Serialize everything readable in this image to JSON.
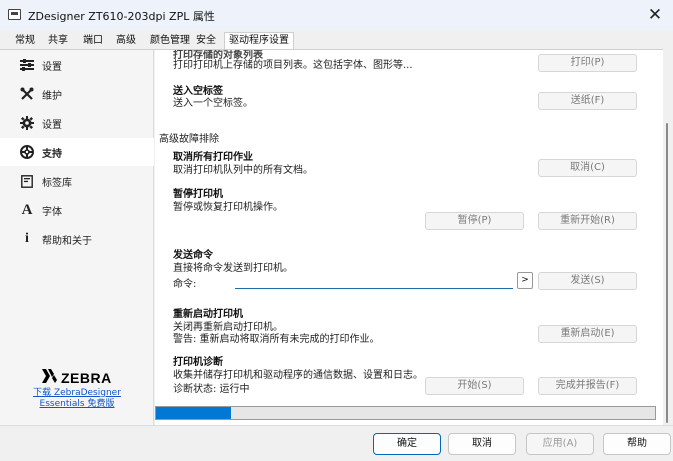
{
  "window": {
    "title": "ZDesigner ZT610-203dpi ZPL 属性",
    "close_glyph": "✕"
  },
  "tabs": [
    {
      "label": "常规"
    },
    {
      "label": "共享"
    },
    {
      "label": "端口"
    },
    {
      "label": "高级"
    },
    {
      "label": "颜色管理"
    },
    {
      "label": "安全"
    },
    {
      "label": "驱动程序设置",
      "active": true
    }
  ],
  "sidebar": {
    "items": [
      {
        "label": "设置",
        "icon": "sliders-icon"
      },
      {
        "label": "维护",
        "icon": "tools-icon"
      },
      {
        "label": "设置",
        "icon": "gear-icon"
      },
      {
        "label": "支持",
        "icon": "lifebuoy-icon",
        "active": true
      },
      {
        "label": "标签库",
        "icon": "label-library-icon"
      },
      {
        "label": "字体",
        "icon": "font-icon"
      },
      {
        "label": "帮助和关于",
        "icon": "info-icon"
      }
    ],
    "brand": {
      "name": "ZEBRA",
      "link_line1": "下载 ZebraDesigner",
      "link_line2": "Essentials 免费版"
    }
  },
  "content": {
    "overflow_title": "打印存储的对象列表",
    "stored_objects": {
      "desc": "打印打印机上存储的项目列表。这包括字体、图形等...",
      "button": "打印(P)"
    },
    "feed_blank": {
      "title": "送入空标签",
      "desc": "送入一个空标签。",
      "button": "送纸(F)"
    },
    "advanced_header": "高级故障排除",
    "cancel_all": {
      "title": "取消所有打印作业",
      "desc": "取消打印机队列中的所有文档。",
      "button": "取消(C)"
    },
    "pause": {
      "title": "暂停打印机",
      "desc": "暂停或恢复打印机操作。",
      "pause_button": "暂停(P)",
      "resume_button": "重新开始(R)"
    },
    "send_command": {
      "title": "发送命令",
      "desc": "直接将命令发送到打印机。",
      "label": "命令:",
      "value": "",
      "arrow_button": ">",
      "send_button": "发送(S)"
    },
    "restart": {
      "title": "重新启动打印机",
      "desc": "关闭再重新启动打印机。",
      "warning": "警告: 重新启动将取消所有未完成的打印作业。",
      "button": "重新启动(E)"
    },
    "diagnostics": {
      "title": "打印机诊断",
      "desc": "收集并储存打印机和驱动程序的通信数据、设置和日志。",
      "status": "诊断状态: 运行中",
      "start_button": "开始(S)",
      "finish_button": "完成并报告(F)"
    },
    "progress_fraction": 0.15
  },
  "footer": {
    "ok": "确定",
    "cancel": "取消",
    "apply": "应用(A)",
    "help": "帮助"
  }
}
